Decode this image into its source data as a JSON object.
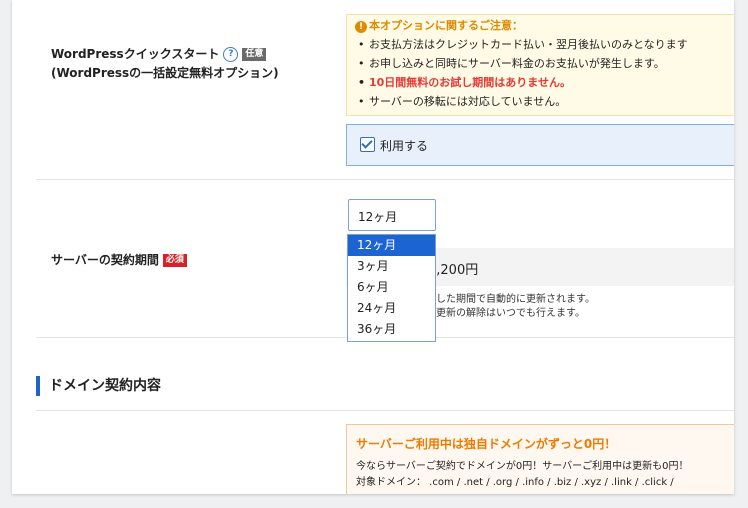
{
  "wp_quickstart": {
    "label_line1": "WordPressクイックスタート",
    "label_line2": "(WordPressの一括設定無料オプション)",
    "help_icon": "?",
    "tag": "任意",
    "notice_icon": "!",
    "notice_title": "本オプションに関するご注意：",
    "notice_items": [
      "お支払方法はクレジットカード払い・翌月後払いのみとなります",
      "お申し込みと同時にサーバー料金のお支払いが発生します。",
      "10日間無料のお試し期間はありません。",
      "サーバーの移転には対応していません。"
    ],
    "use_label": "利用する",
    "use_checked": true
  },
  "contract": {
    "label": "サーバーの契約期間",
    "tag": "必須",
    "selected": "12ヶ月",
    "options": [
      "12ヶ月",
      "3ヶ月",
      "6ヶ月",
      "24ヶ月",
      "36ヶ月"
    ],
    "price_visible": "3,200円",
    "note_line1": "した期間で自動的に更新されます。",
    "note_line2": "更新の解除はいつでも行えます。"
  },
  "domain_section": {
    "title": "ドメイン契約内容",
    "promo_title": "サーバーご利用中は独自ドメインがずっと0円！",
    "promo_line1": "今ならサーバーご契約でドメインが0円！サーバーご利用中は更新も0円！",
    "promo_line2": "対象ドメイン： .com / .net / .org / .info / .biz / .xyz / .link / .click /"
  },
  "colors": {
    "accent_blue": "#1f64c8",
    "required_red": "#d92027",
    "warning_orange": "#e08a00",
    "promo_orange": "#f07a00"
  }
}
